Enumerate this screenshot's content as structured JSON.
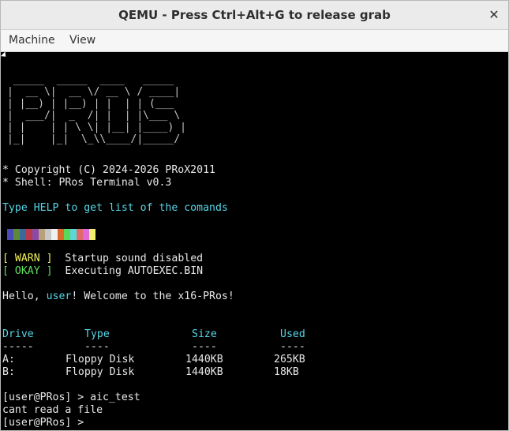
{
  "window": {
    "title": "QEMU - Press Ctrl+Alt+G to release grab",
    "close_glyph": "✕"
  },
  "menubar": {
    "items": [
      "Machine",
      "View"
    ]
  },
  "terminal": {
    "logo_text": " _____  _____  ____   _____\n|  __ \\|  __ \\/ __ \\ / ____|\n| |__) | |__) | |  | | (___\n|  ___/|  _  /| |  | |\\___ \\\n| |    | | \\ \\| |__| |____) |\n|_|    |_|  \\_\\\\____/|_____/",
    "copyright": "* Copyright (C) 2024-2026 PRoX2011",
    "shell": "* Shell: PRos Terminal v0.3",
    "help_hint": "Type HELP to get list of the comands",
    "palette": [
      "#4a4ab8",
      "#5a8a3a",
      "#3a6a9a",
      "#b83a4a",
      "#8a4aa8",
      "#b8a078",
      "#c8c8c8",
      "#f0f0f0",
      "#d86a2a",
      "#5ad85a",
      "#5ad8d8",
      "#e06a6a",
      "#e06ad8",
      "#f0f070"
    ],
    "warn_tag": "[ WARN ]",
    "warn_msg": "Startup sound disabled",
    "okay_tag": "[ OKAY ]",
    "okay_msg": "Executing AUTOEXEC.BIN",
    "greeting_pre": "Hello, ",
    "greeting_user": "user",
    "greeting_post": "! Welcome to the x16-PRos!",
    "table": {
      "headers": [
        "Drive",
        "Type",
        "Size",
        "Used"
      ],
      "separators": [
        "-----",
        "----",
        "----",
        "----"
      ],
      "rows": [
        [
          "A:",
          "Floppy Disk",
          "1440KB",
          "265KB"
        ],
        [
          "B:",
          "Floppy Disk",
          "1440KB",
          "18KB"
        ]
      ]
    },
    "prompt1": "[user@PRos] > aic_test",
    "output1": "cant read a file",
    "prompt2": "[user@PRos] >"
  }
}
